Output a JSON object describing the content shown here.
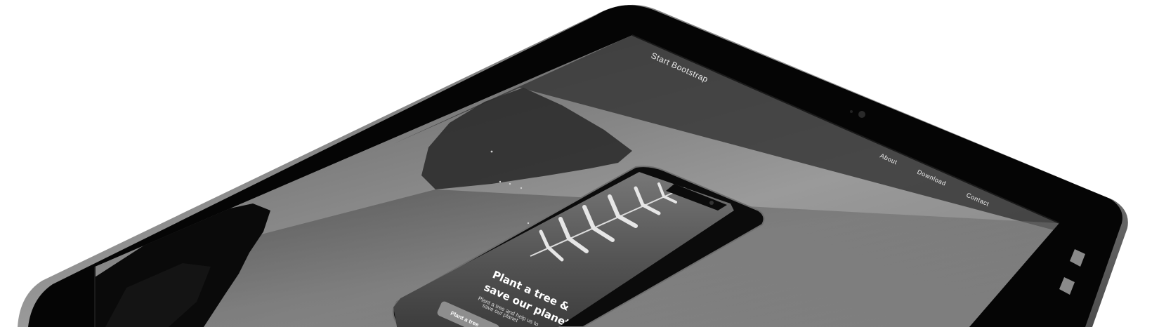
{
  "site": {
    "brand": "Start Bootstrap",
    "nav": {
      "items": [
        {
          "label": "About"
        },
        {
          "label": "Download"
        },
        {
          "label": "Contact"
        }
      ]
    }
  },
  "phone_screen": {
    "headline_line1": "Plant a tree &",
    "headline_line2": "save our planet",
    "sub_line1": "Plant a tree and help us to",
    "sub_line2": "save our planet",
    "cta_label": "Plant a tree"
  }
}
